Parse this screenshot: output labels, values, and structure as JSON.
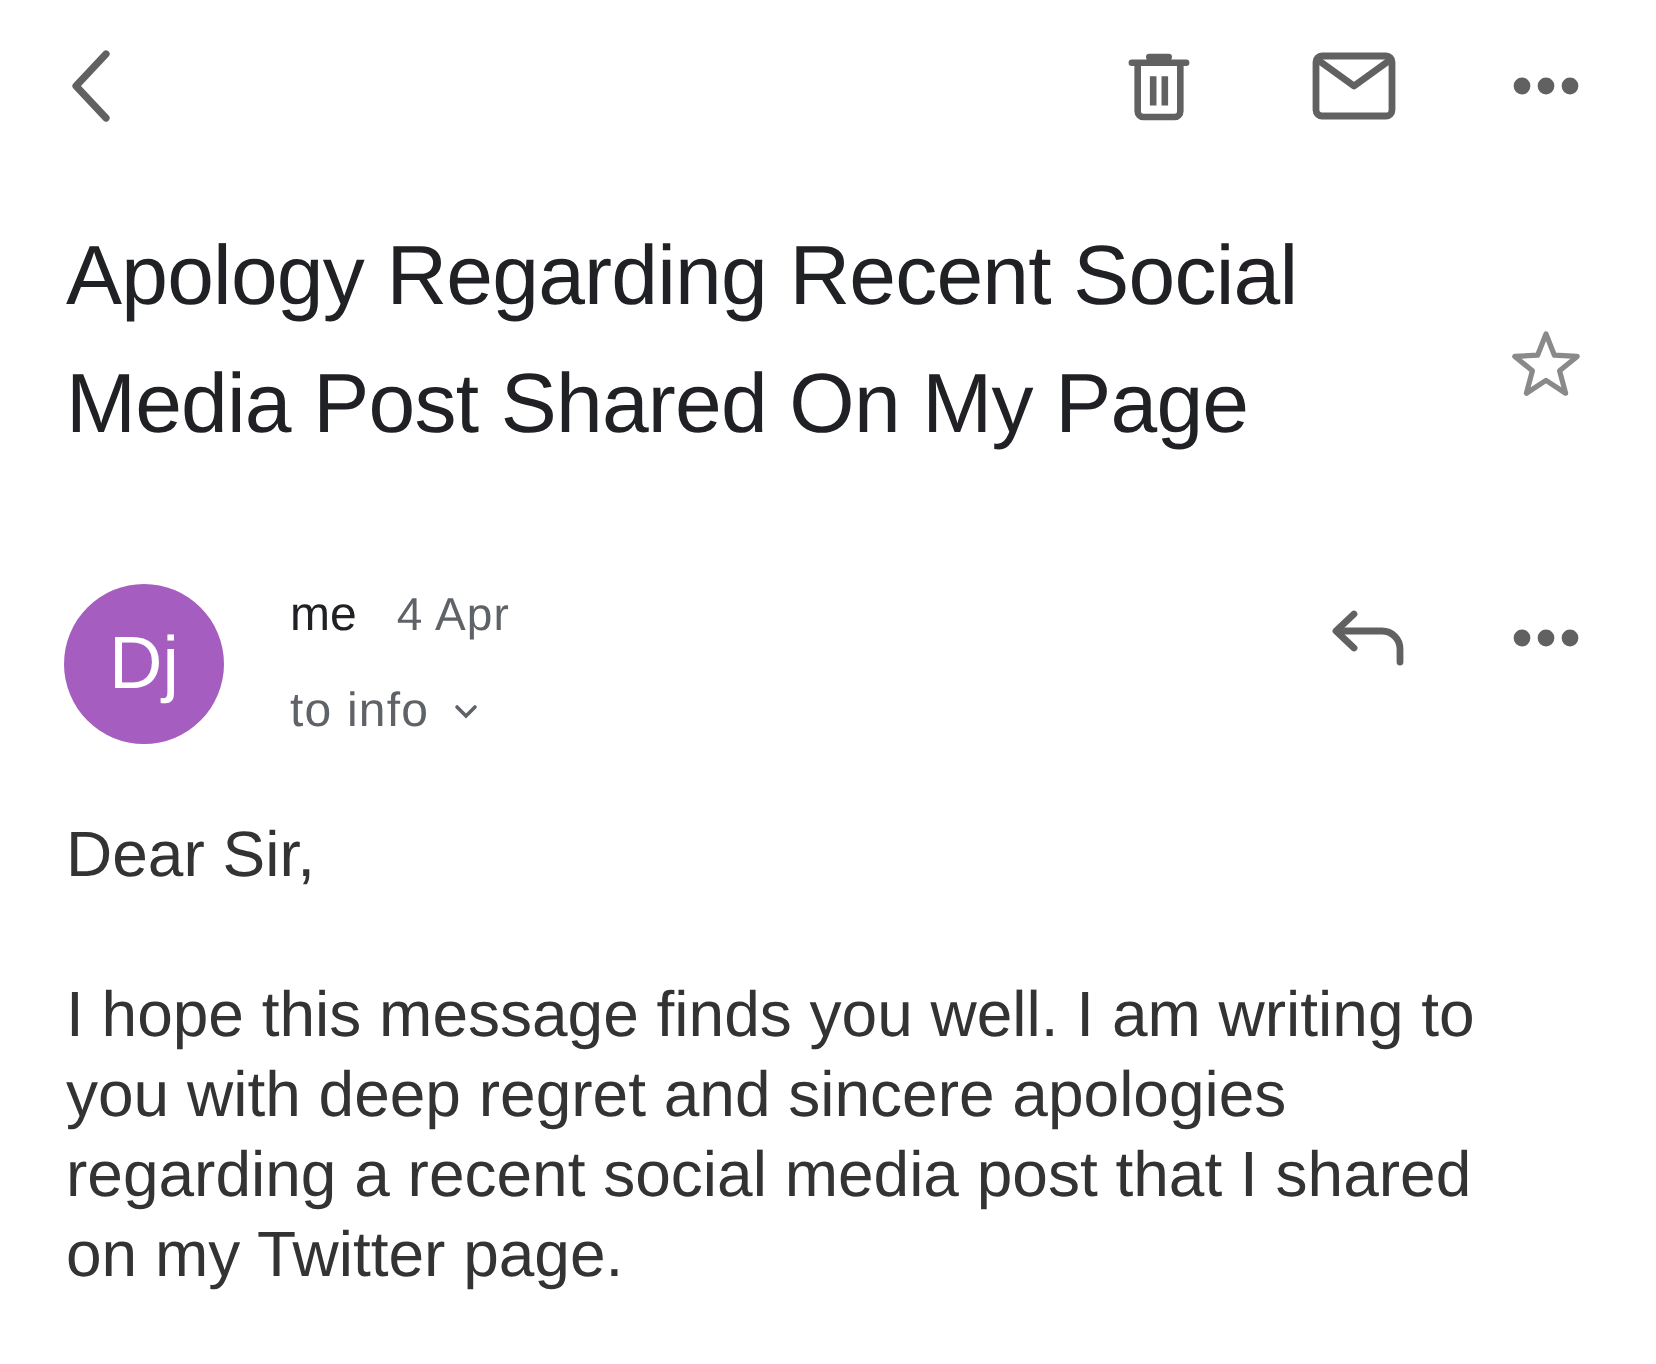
{
  "subject": {
    "title": "Apology Regarding Recent Social Media Post Shared On My Page",
    "starred": false
  },
  "message": {
    "avatar_initials": "Dj",
    "sender": "me",
    "date": "4 Apr",
    "recipient": "to info",
    "details_expanded": false
  },
  "body": {
    "greeting": "Dear Sir,",
    "paragraphs": [
      "I hope this message finds you well. I am writing to you with deep regret and sincere apologies regarding a recent social media post that I shared on my Twitter page."
    ]
  }
}
